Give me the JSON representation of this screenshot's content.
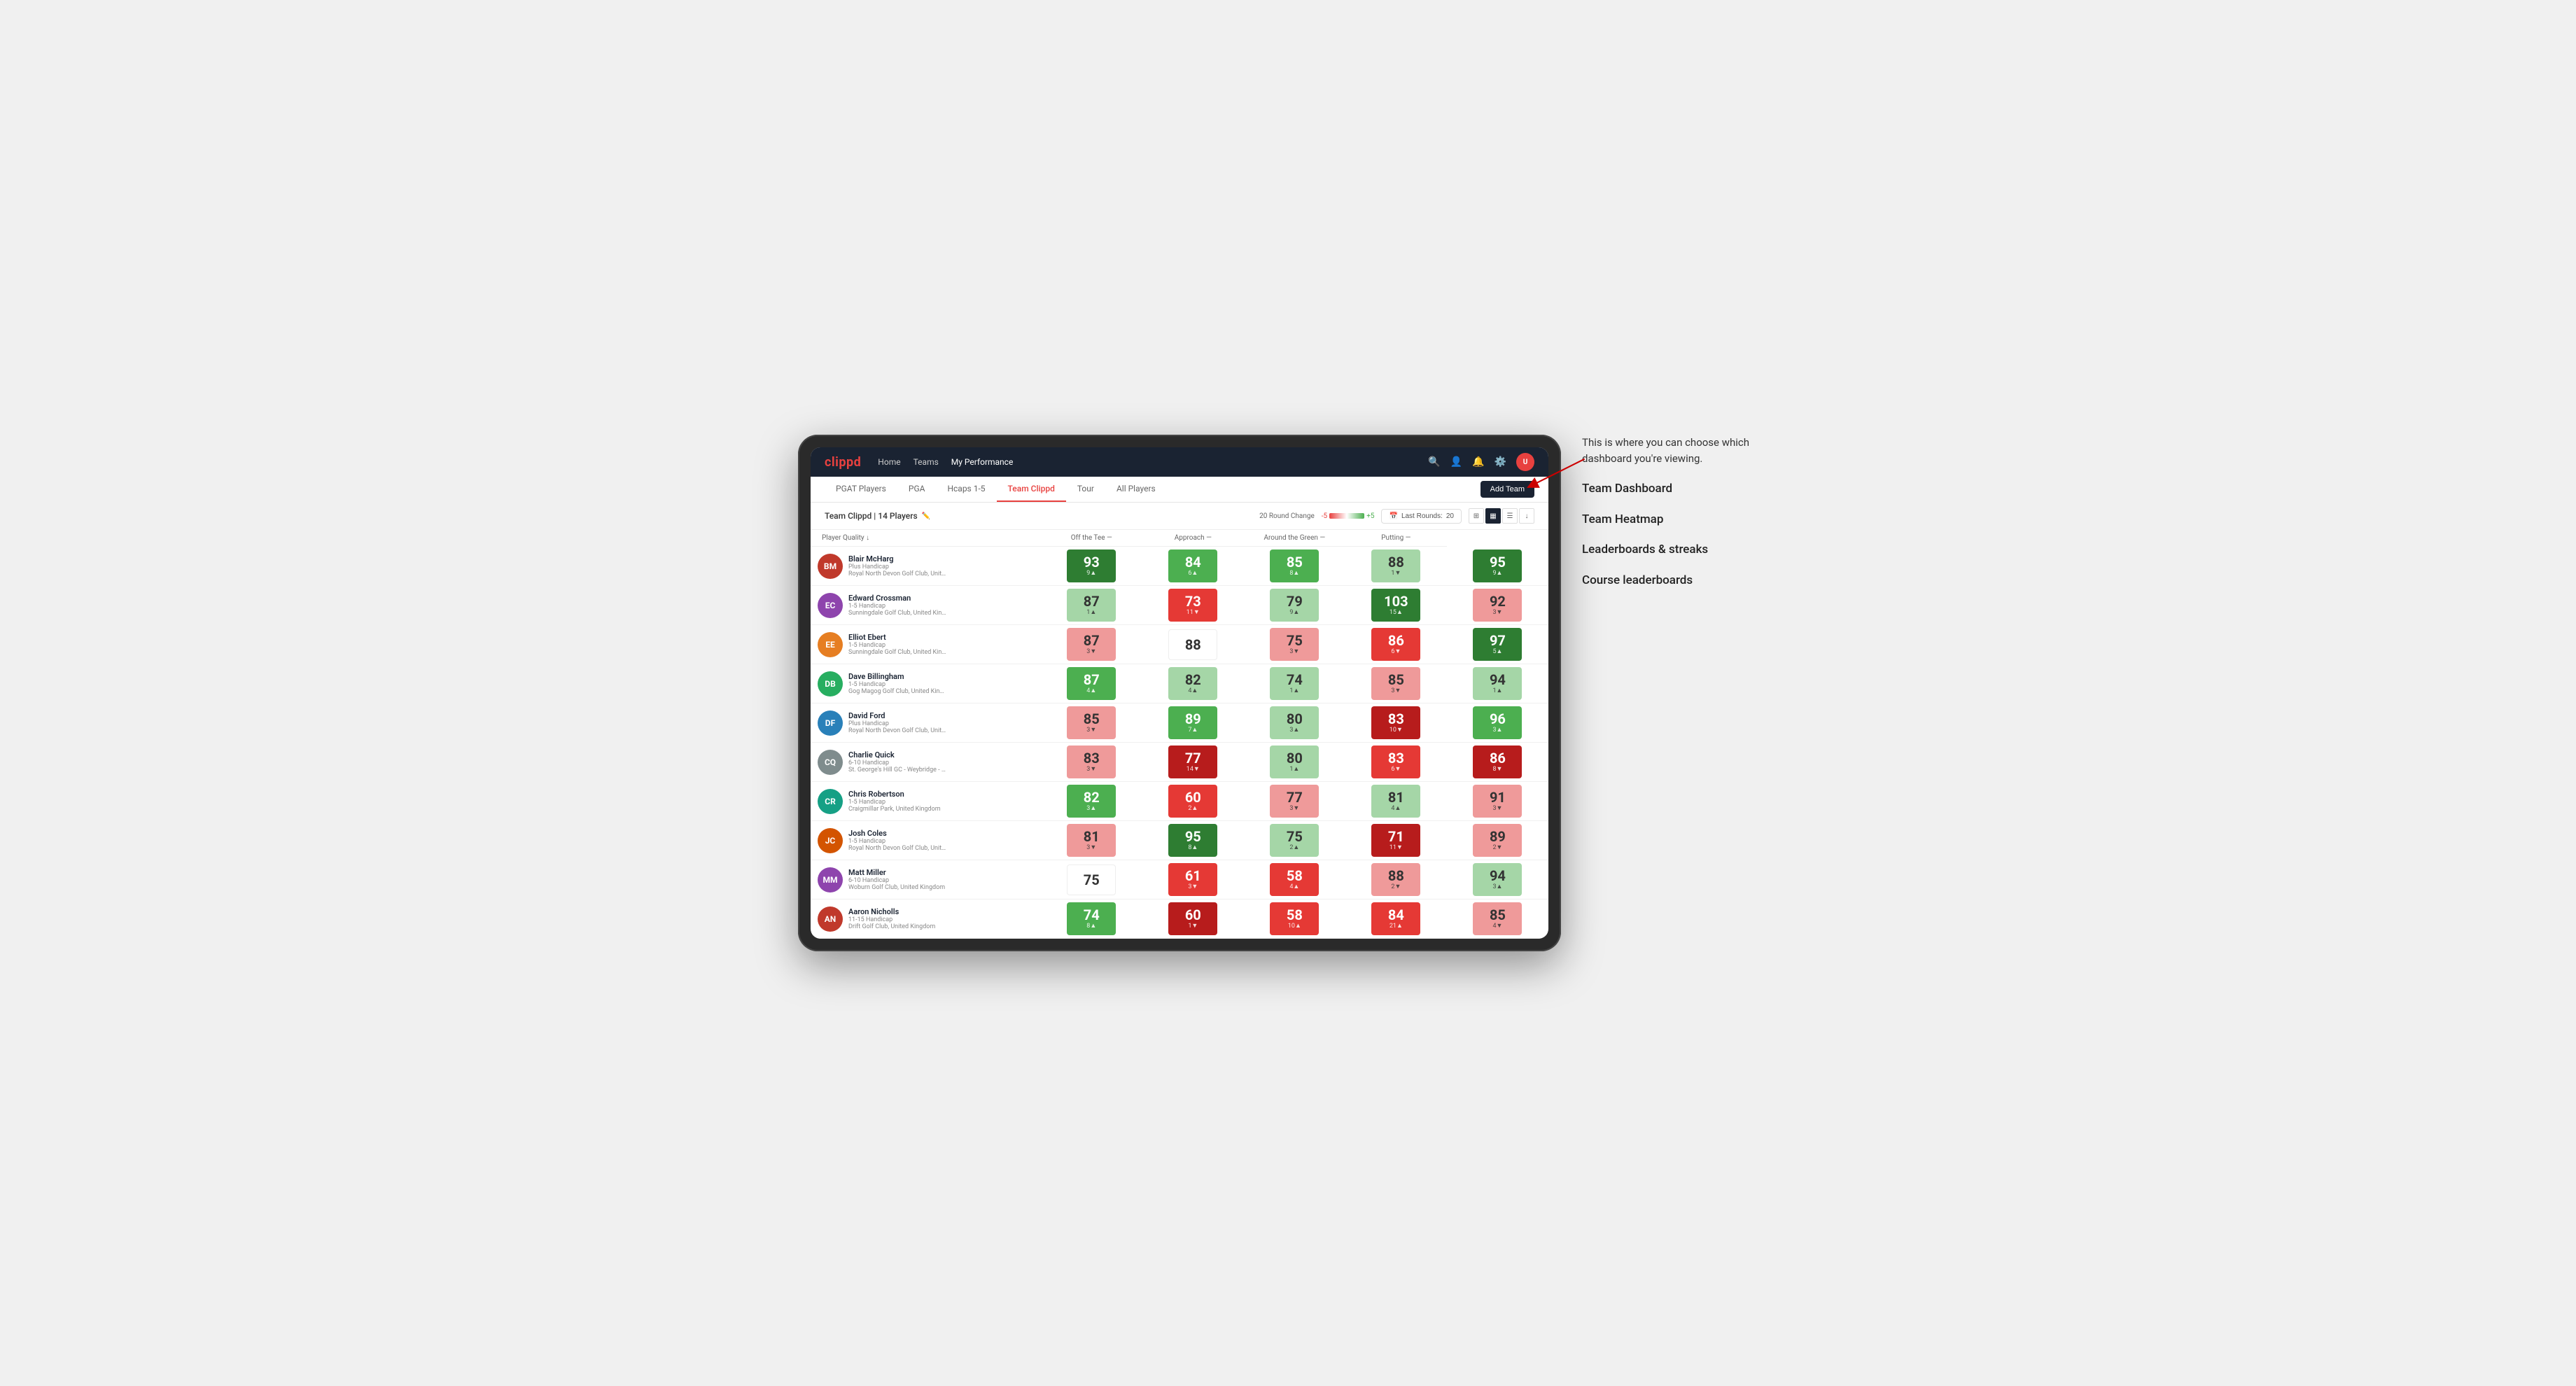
{
  "annotation": {
    "intro": "This is where you can choose which dashboard you're viewing.",
    "items": [
      "Team Dashboard",
      "Team Heatmap",
      "Leaderboards & streaks",
      "Course leaderboards"
    ]
  },
  "nav": {
    "logo": "clippd",
    "links": [
      "Home",
      "Teams",
      "My Performance"
    ],
    "active_link": "My Performance"
  },
  "sub_tabs": {
    "tabs": [
      "PGAT Players",
      "PGA",
      "Hcaps 1-5",
      "Team Clippd",
      "Tour",
      "All Players"
    ],
    "active": "Team Clippd",
    "add_button": "Add Team"
  },
  "team_bar": {
    "title": "Team Clippd",
    "player_count": "14 Players",
    "round_change_label": "20 Round Change",
    "scale_neg": "-5",
    "scale_pos": "+5",
    "last_rounds_label": "Last Rounds:",
    "last_rounds_value": "20"
  },
  "table": {
    "headers": {
      "player": "Player Quality ↓",
      "tee": "Off the Tee —",
      "approach": "Approach —",
      "green": "Around the Green —",
      "putting": "Putting —"
    },
    "players": [
      {
        "name": "Blair McHarg",
        "handicap": "Plus Handicap",
        "club": "Royal North Devon Golf Club, United Kingdom",
        "color": "#c0392b",
        "quality": {
          "score": "93",
          "change": "9▲",
          "color": "green-dark"
        },
        "tee": {
          "score": "84",
          "change": "6▲",
          "color": "green-med"
        },
        "approach": {
          "score": "85",
          "change": "8▲",
          "color": "green-med"
        },
        "green": {
          "score": "88",
          "change": "1▼",
          "color": "green-light"
        },
        "putting": {
          "score": "95",
          "change": "9▲",
          "color": "green-dark"
        }
      },
      {
        "name": "Edward Crossman",
        "handicap": "1-5 Handicap",
        "club": "Sunningdale Golf Club, United Kingdom",
        "color": "#8e44ad",
        "quality": {
          "score": "87",
          "change": "1▲",
          "color": "green-light"
        },
        "tee": {
          "score": "73",
          "change": "11▼",
          "color": "red-med"
        },
        "approach": {
          "score": "79",
          "change": "9▲",
          "color": "green-light"
        },
        "green": {
          "score": "103",
          "change": "15▲",
          "color": "green-dark"
        },
        "putting": {
          "score": "92",
          "change": "3▼",
          "color": "red-light"
        }
      },
      {
        "name": "Elliot Ebert",
        "handicap": "1-5 Handicap",
        "club": "Sunningdale Golf Club, United Kingdom",
        "color": "#e67e22",
        "quality": {
          "score": "87",
          "change": "3▼",
          "color": "red-light"
        },
        "tee": {
          "score": "88",
          "change": "",
          "color": "white-cell"
        },
        "approach": {
          "score": "75",
          "change": "3▼",
          "color": "red-light"
        },
        "green": {
          "score": "86",
          "change": "6▼",
          "color": "red-med"
        },
        "putting": {
          "score": "97",
          "change": "5▲",
          "color": "green-dark"
        }
      },
      {
        "name": "Dave Billingham",
        "handicap": "1-5 Handicap",
        "club": "Gog Magog Golf Club, United Kingdom",
        "color": "#27ae60",
        "quality": {
          "score": "87",
          "change": "4▲",
          "color": "green-med"
        },
        "tee": {
          "score": "82",
          "change": "4▲",
          "color": "green-light"
        },
        "approach": {
          "score": "74",
          "change": "1▲",
          "color": "green-light"
        },
        "green": {
          "score": "85",
          "change": "3▼",
          "color": "red-light"
        },
        "putting": {
          "score": "94",
          "change": "1▲",
          "color": "green-light"
        }
      },
      {
        "name": "David Ford",
        "handicap": "Plus Handicap",
        "club": "Royal North Devon Golf Club, United Kingdom",
        "color": "#2980b9",
        "quality": {
          "score": "85",
          "change": "3▼",
          "color": "red-light"
        },
        "tee": {
          "score": "89",
          "change": "7▲",
          "color": "green-med"
        },
        "approach": {
          "score": "80",
          "change": "3▲",
          "color": "green-light"
        },
        "green": {
          "score": "83",
          "change": "10▼",
          "color": "red-dark"
        },
        "putting": {
          "score": "96",
          "change": "3▲",
          "color": "green-med"
        }
      },
      {
        "name": "Charlie Quick",
        "handicap": "6-10 Handicap",
        "club": "St. George's Hill GC - Weybridge - Surrey, Uni...",
        "color": "#7f8c8d",
        "quality": {
          "score": "83",
          "change": "3▼",
          "color": "red-light"
        },
        "tee": {
          "score": "77",
          "change": "14▼",
          "color": "red-dark"
        },
        "approach": {
          "score": "80",
          "change": "1▲",
          "color": "green-light"
        },
        "green": {
          "score": "83",
          "change": "6▼",
          "color": "red-med"
        },
        "putting": {
          "score": "86",
          "change": "8▼",
          "color": "red-dark"
        }
      },
      {
        "name": "Chris Robertson",
        "handicap": "1-5 Handicap",
        "club": "Craigmillar Park, United Kingdom",
        "color": "#16a085",
        "quality": {
          "score": "82",
          "change": "3▲",
          "color": "green-med"
        },
        "tee": {
          "score": "60",
          "change": "2▲",
          "color": "red-med"
        },
        "approach": {
          "score": "77",
          "change": "3▼",
          "color": "red-light"
        },
        "green": {
          "score": "81",
          "change": "4▲",
          "color": "green-light"
        },
        "putting": {
          "score": "91",
          "change": "3▼",
          "color": "red-light"
        }
      },
      {
        "name": "Josh Coles",
        "handicap": "1-5 Handicap",
        "club": "Royal North Devon Golf Club, United Kingdom",
        "color": "#d35400",
        "quality": {
          "score": "81",
          "change": "3▼",
          "color": "red-light"
        },
        "tee": {
          "score": "95",
          "change": "8▲",
          "color": "green-dark"
        },
        "approach": {
          "score": "75",
          "change": "2▲",
          "color": "green-light"
        },
        "green": {
          "score": "71",
          "change": "11▼",
          "color": "red-dark"
        },
        "putting": {
          "score": "89",
          "change": "2▼",
          "color": "red-light"
        }
      },
      {
        "name": "Matt Miller",
        "handicap": "6-10 Handicap",
        "club": "Woburn Golf Club, United Kingdom",
        "color": "#8e44ad",
        "quality": {
          "score": "75",
          "change": "",
          "color": "white-cell"
        },
        "tee": {
          "score": "61",
          "change": "3▼",
          "color": "red-med"
        },
        "approach": {
          "score": "58",
          "change": "4▲",
          "color": "red-med"
        },
        "green": {
          "score": "88",
          "change": "2▼",
          "color": "red-light"
        },
        "putting": {
          "score": "94",
          "change": "3▲",
          "color": "green-light"
        }
      },
      {
        "name": "Aaron Nicholls",
        "handicap": "11-15 Handicap",
        "club": "Drift Golf Club, United Kingdom",
        "color": "#c0392b",
        "quality": {
          "score": "74",
          "change": "8▲",
          "color": "green-med"
        },
        "tee": {
          "score": "60",
          "change": "1▼",
          "color": "red-dark"
        },
        "approach": {
          "score": "58",
          "change": "10▲",
          "color": "red-med"
        },
        "green": {
          "score": "84",
          "change": "21▲",
          "color": "red-med"
        },
        "putting": {
          "score": "85",
          "change": "4▼",
          "color": "red-light"
        }
      }
    ]
  }
}
